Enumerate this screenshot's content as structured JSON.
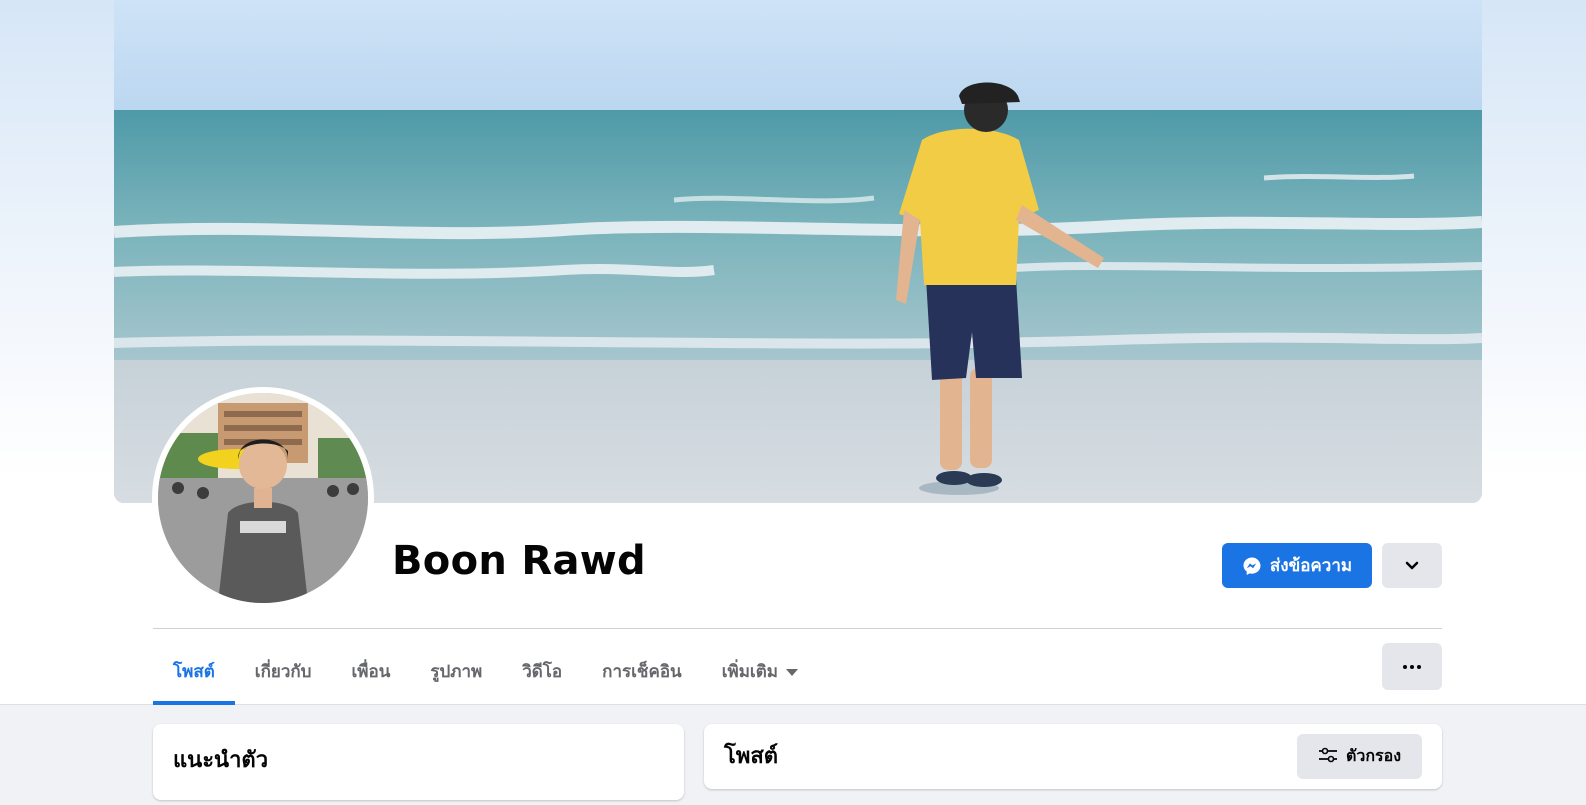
{
  "profile": {
    "name": "Boon Rawd"
  },
  "actions": {
    "message_label": "ส่งข้อความ"
  },
  "tabs": [
    {
      "label": "โพสต์",
      "active": true
    },
    {
      "label": "เกี่ยวกับ",
      "active": false
    },
    {
      "label": "เพื่อน",
      "active": false
    },
    {
      "label": "รูปภาพ",
      "active": false
    },
    {
      "label": "วิดีโอ",
      "active": false
    },
    {
      "label": "การเช็คอิน",
      "active": false
    },
    {
      "label": "เพิ่มเติม",
      "active": false
    }
  ],
  "intro": {
    "title": "แนะนำตัว"
  },
  "posts": {
    "title": "โพสต์",
    "filter_label": "ตัวกรอง"
  },
  "colors": {
    "accent": "#1b74e4",
    "button_gray": "#e4e6eb",
    "tab_text": "#65676b"
  },
  "icons": {
    "message": "messenger-icon",
    "dropdown": "chevron-down-icon",
    "more": "more-dots-icon",
    "filter": "filter-sliders-icon",
    "tab_more": "caret-down-icon"
  }
}
